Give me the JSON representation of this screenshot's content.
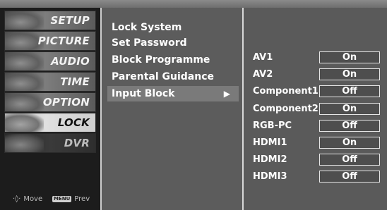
{
  "categories": [
    {
      "label": "SETUP",
      "icon": "satellite-dish-icon"
    },
    {
      "label": "PICTURE",
      "icon": "picture-icon"
    },
    {
      "label": "AUDIO",
      "icon": "speaker-icon"
    },
    {
      "label": "TIME",
      "icon": "clock-icon"
    },
    {
      "label": "OPTION",
      "icon": "option-icon"
    },
    {
      "label": "LOCK",
      "icon": "lock-icon"
    },
    {
      "label": "DVR",
      "icon": "disc-icon"
    }
  ],
  "active_category": "LOCK",
  "menu": {
    "items": [
      {
        "label": "Lock System"
      },
      {
        "label": "Set Password"
      },
      {
        "label": "Block Programme"
      },
      {
        "label": "Parental Guidance"
      },
      {
        "label": "Input Block",
        "arrow": "▶"
      }
    ],
    "active_item": "Input Block"
  },
  "inputs": [
    {
      "name": "AV1",
      "value": "On"
    },
    {
      "name": "AV2",
      "value": "On"
    },
    {
      "name": "Component1",
      "value": "Off"
    },
    {
      "name": "Component2",
      "value": "On"
    },
    {
      "name": "RGB-PC",
      "value": "Off"
    },
    {
      "name": "HDMI1",
      "value": "On"
    },
    {
      "name": "HDMI2",
      "value": "Off"
    },
    {
      "name": "HDMI3",
      "value": "Off"
    }
  ],
  "hints": {
    "move_label": "Move",
    "menu_key": "MENU",
    "prev_label": "Prev"
  },
  "colors": {
    "background": "#5a5a5a",
    "left_panel": "#1c1c1c",
    "text": "#ffffff"
  }
}
